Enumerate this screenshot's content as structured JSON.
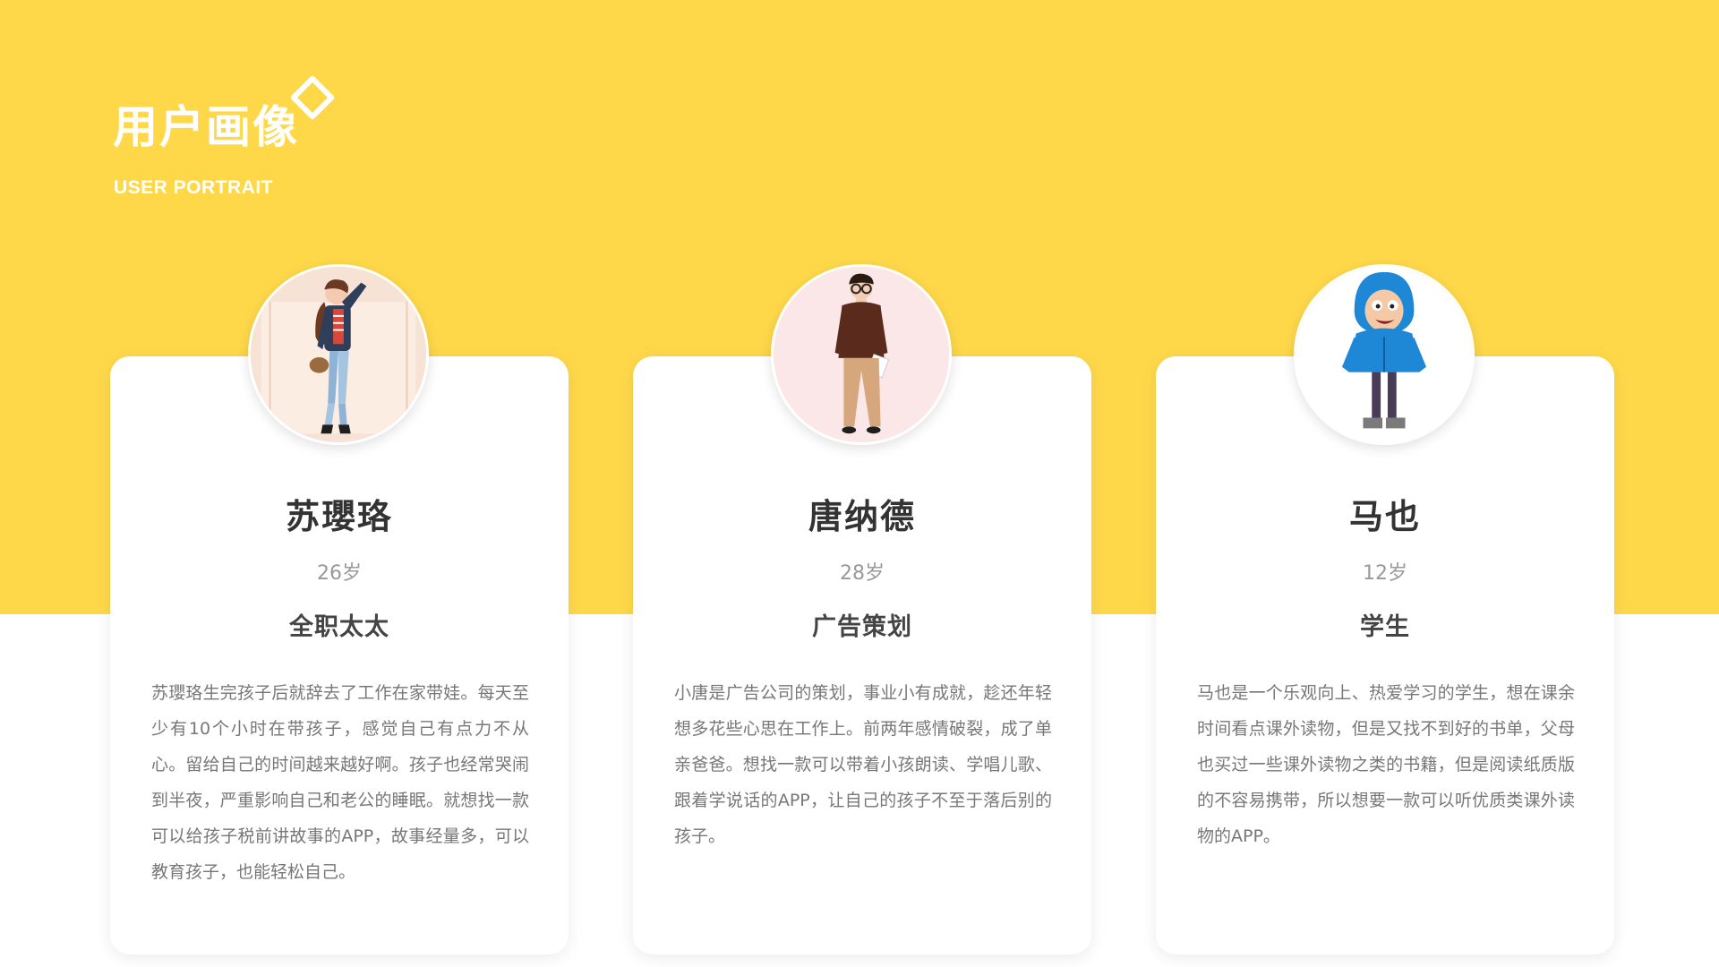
{
  "header": {
    "title": "用户画像",
    "subtitle": "USER PORTRAIT"
  },
  "personas": [
    {
      "name": "苏瓔珞",
      "age": "26岁",
      "role": "全职太太",
      "description": "苏瓔珞生完孩子后就辞去了工作在家带娃。每天至少有10个小时在带孩子，感觉自己有点力不从心。留给自己的时间越来越好啊。孩子也经常哭闹到半夜，严重影响自己和老公的睡眠。就想找一款可以给孩子税前讲故事的APP，故事经量多，可以教育孩子，也能轻松自己。"
    },
    {
      "name": "唐纳德",
      "age": "28岁",
      "role": "广告策划",
      "description": "小唐是广告公司的策划，事业小有成就，趁还年轻想多花些心思在工作上。前两年感情破裂，成了单亲爸爸。想找一款可以带着小孩朗读、学唱儿歌、跟着学说话的APP，让自己的孩子不至于落后别的孩子。"
    },
    {
      "name": "马也",
      "age": "12岁",
      "role": "学生",
      "description": "马也是一个乐观向上、热爱学习的学生，想在课余时间看点课外读物，但是又找不到好的书单，父母也买过一些课外读物之类的书籍，但是阅读纸质版的不容易携带，所以想要一款可以听优质类课外读物的APP。"
    }
  ],
  "colors": {
    "accent": "#FFD84A",
    "card": "#FFFFFF",
    "text_dark": "#333333",
    "text_muted": "#777777"
  }
}
